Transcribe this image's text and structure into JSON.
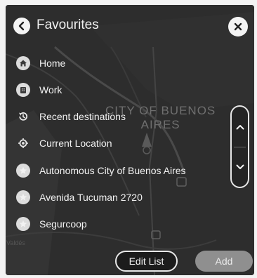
{
  "header": {
    "title": "Favourites",
    "back_icon": "chevron-left-icon",
    "close_icon": "close-icon"
  },
  "map": {
    "city_label_line1": "CITY OF BUENOS",
    "city_label_line2": "AIRES",
    "small_label": "Valdés"
  },
  "favourites": [
    {
      "label": "Home",
      "icon": "home-icon"
    },
    {
      "label": "Work",
      "icon": "briefcase-icon"
    },
    {
      "label": "Recent destinations",
      "icon": "recent-icon"
    },
    {
      "label": "Current Location",
      "icon": "location-target-icon"
    },
    {
      "label": "Autonomous City of Buenos Aires",
      "icon": "star-icon"
    },
    {
      "label": "Avenida Tucuman 2720",
      "icon": "star-icon"
    },
    {
      "label": "Segurcoop",
      "icon": "star-icon"
    }
  ],
  "actions": {
    "edit_list": "Edit List",
    "add": "Add"
  },
  "colors": {
    "background": "#2c2c2c",
    "text": "#f2f2f2",
    "add_button": "#8f8f8f"
  }
}
